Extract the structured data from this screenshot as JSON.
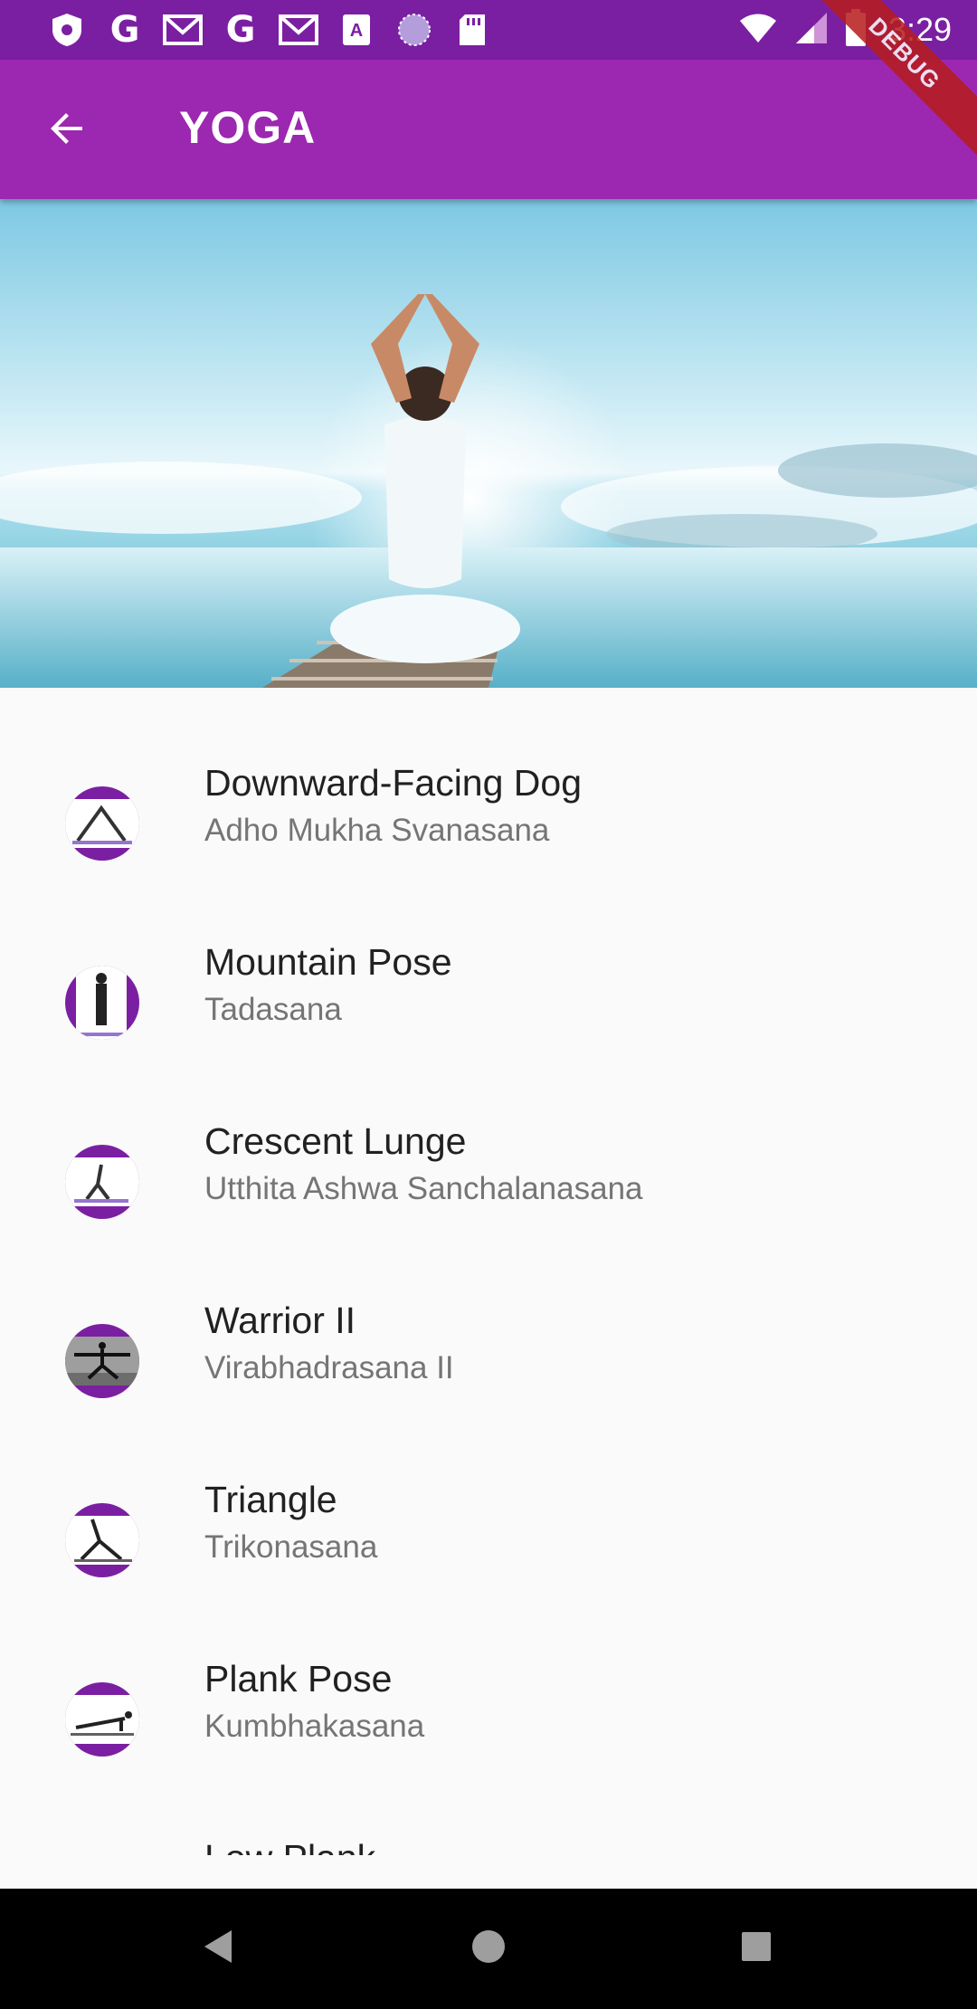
{
  "status_bar": {
    "time": "3:29",
    "left_icons": [
      "shield-icon",
      "google-icon",
      "gmail-icon",
      "google-icon",
      "gmail-icon",
      "accessibility-icon",
      "sync-icon",
      "sd-card-icon"
    ],
    "right_icons": [
      "wifi-icon",
      "signal-icon",
      "battery-icon"
    ]
  },
  "app_bar": {
    "title": "YOGA",
    "back_icon": "arrow-back-icon"
  },
  "debug_banner": "DEBUG",
  "hero": {
    "image": "yoga-meditation-by-sea"
  },
  "poses": [
    {
      "title": "Downward-Facing Dog",
      "subtitle": "Adho Mukha Svanasana"
    },
    {
      "title": "Mountain Pose",
      "subtitle": "Tadasana"
    },
    {
      "title": "Crescent Lunge",
      "subtitle": "Utthita Ashwa Sanchalanasana"
    },
    {
      "title": "Warrior II",
      "subtitle": "Virabhadrasana II"
    },
    {
      "title": "Triangle",
      "subtitle": "Trikonasana"
    },
    {
      "title": "Plank Pose",
      "subtitle": "Kumbhakasana"
    },
    {
      "title": "Low Plank",
      "subtitle": ""
    }
  ],
  "colors": {
    "status_bar": "#7b1fa2",
    "app_bar": "#9c27b0",
    "avatar": "#7b1fa2",
    "background": "#fafafa"
  },
  "nav_bar": {
    "icons": [
      "back-triangle-icon",
      "home-circle-icon",
      "recents-square-icon"
    ]
  }
}
